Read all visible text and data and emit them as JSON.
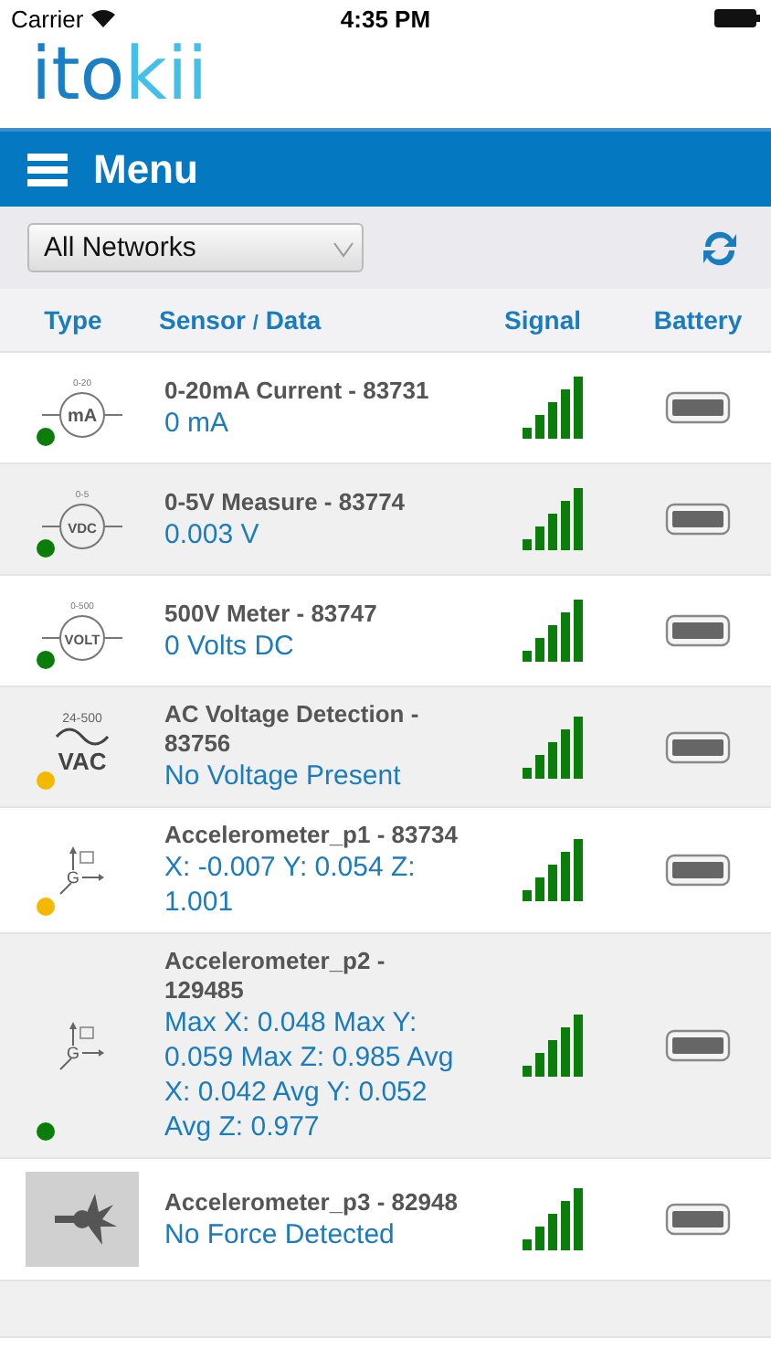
{
  "status_bar": {
    "carrier": "Carrier",
    "time": "4:35 PM"
  },
  "logo": {
    "part_1": "ito",
    "part_2": "kii"
  },
  "menu_bar": {
    "title": "Menu"
  },
  "filter": {
    "value": "All Networks"
  },
  "columns": {
    "type": "Type",
    "sensor": "Sensor",
    "separator": "/",
    "data": "Data",
    "signal": "Signal",
    "battery": "Battery"
  },
  "rows": [
    {
      "kind": "meter",
      "icon_range": "0-20",
      "icon_unit": "mA",
      "color": "#0a7d0a",
      "name": "0-20mA Current - 83731",
      "reading": "0 mA"
    },
    {
      "kind": "meter",
      "icon_range": "0-5",
      "icon_unit": "VDC",
      "color": "#0a7d0a",
      "name": "0-5V Measure - 83774",
      "reading": "0.003 V"
    },
    {
      "kind": "meter",
      "icon_range": "0-500",
      "icon_unit": "VOLT",
      "color": "#0a7d0a",
      "name": "500V Meter - 83747",
      "reading": "0 Volts DC"
    },
    {
      "kind": "wave",
      "icon_range": "24-500",
      "icon_unit": "VAC",
      "color": "#f5b800",
      "name": "AC Voltage Detection - 83756",
      "reading": "No Voltage Present"
    },
    {
      "kind": "accel",
      "icon_unit": "G",
      "color": "#f5b800",
      "name": "Accelerometer_p1 - 83734",
      "reading": "X: -0.007 Y: 0.054 Z: 1.001"
    },
    {
      "kind": "accel",
      "icon_unit": "G",
      "color": "#0a7d0a",
      "name": "Accelerometer_p2 - 129485",
      "reading": "Max X: 0.048 Max Y: 0.059 Max Z: 0.985 Avg X: 0.042 Avg Y: 0.052 Avg Z: 0.977"
    },
    {
      "kind": "impact",
      "name": "Accelerometer_p3 - 82948",
      "reading": "No Force Detected"
    },
    {
      "kind": "cut"
    }
  ]
}
